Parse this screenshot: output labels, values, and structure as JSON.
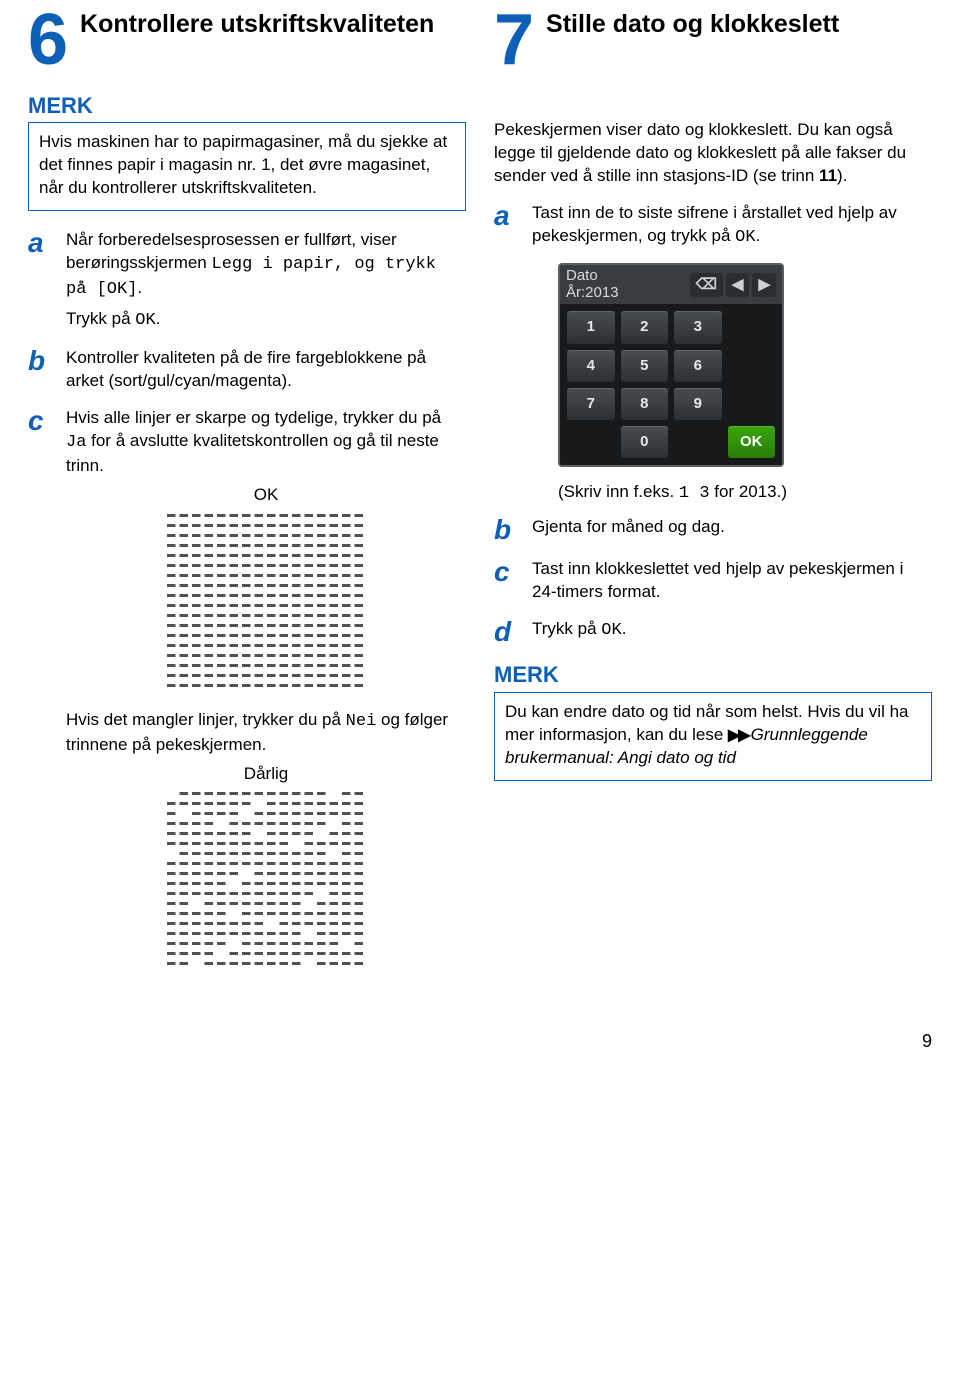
{
  "left": {
    "num": "6",
    "title": "Kontrollere utskriftskvaliteten",
    "merk_label": "MERK",
    "merk_text": "Hvis maskinen har to papirmagasiner, må du sjekke at det finnes papir i magasin nr. 1, det øvre magasinet, når du kontrollerer utskriftskvaliteten.",
    "a": {
      "letter": "a",
      "p1a": "Når forberedelsesprosessen er fullført, viser berøringsskjermen ",
      "p1mono": "Legg i papir, og trykk på [OK]",
      "p1b": ".",
      "p2a": "Trykk på ",
      "p2ok": "OK",
      "p2b": "."
    },
    "b": {
      "letter": "b",
      "text": "Kontroller kvaliteten på de fire fargeblokkene på arket (sort/gul/cyan/magenta)."
    },
    "c": {
      "letter": "c",
      "p1a": "Hvis alle linjer er skarpe og tydelige, trykker du på ",
      "p1mono": "Ja",
      "p1b": " for å avslutte kvalitetskontrollen og gå til neste trinn.",
      "ok_label": "OK",
      "after_a": "Hvis det mangler linjer, trykker du på ",
      "after_mono": "Nei",
      "after_b": " og følger trinnene på pekeskjermen.",
      "bad_label": "Dårlig"
    }
  },
  "right": {
    "num": "7",
    "title": "Stille dato og klokkeslett",
    "intro_a": "Pekeskjermen viser dato og klokkeslett. Du kan også legge til gjeldende dato og klokkeslett på alle fakser du sender ved å stille inn stasjons-ID (se trinn ",
    "intro_ref": "11",
    "intro_b": ").",
    "a": {
      "letter": "a",
      "p1a": "Tast inn de to siste sifrene i årstallet ved hjelp av pekeskjermen, og trykk på ",
      "p1ok": "OK",
      "p1b": "."
    },
    "touchscreen": {
      "label_date": "Dato",
      "label_year": "År:2013",
      "back": "⌫",
      "left": "◀",
      "right": "▶",
      "keys": [
        "1",
        "2",
        "3",
        "4",
        "5",
        "6",
        "7",
        "8",
        "9",
        "0"
      ],
      "ok": "OK"
    },
    "after_a_a": "(Skriv inn f.eks. ",
    "after_a_mono": "1 3",
    "after_a_b": " for 2013.)",
    "b": {
      "letter": "b",
      "text": "Gjenta for måned og dag."
    },
    "c": {
      "letter": "c",
      "text": "Tast inn klokkeslettet ved hjelp av pekeskjermen i 24-timers format."
    },
    "d": {
      "letter": "d",
      "p1a": "Trykk på ",
      "p1ok": "OK",
      "p1b": "."
    },
    "merk_label": "MERK",
    "merk_text": "Du kan endre dato og tid når som helst. Hvis du vil ha mer informasjon, kan du lese ",
    "merk_ref": "Grunnleggende brukermanual: Angi dato og tid"
  },
  "page_number": "9"
}
